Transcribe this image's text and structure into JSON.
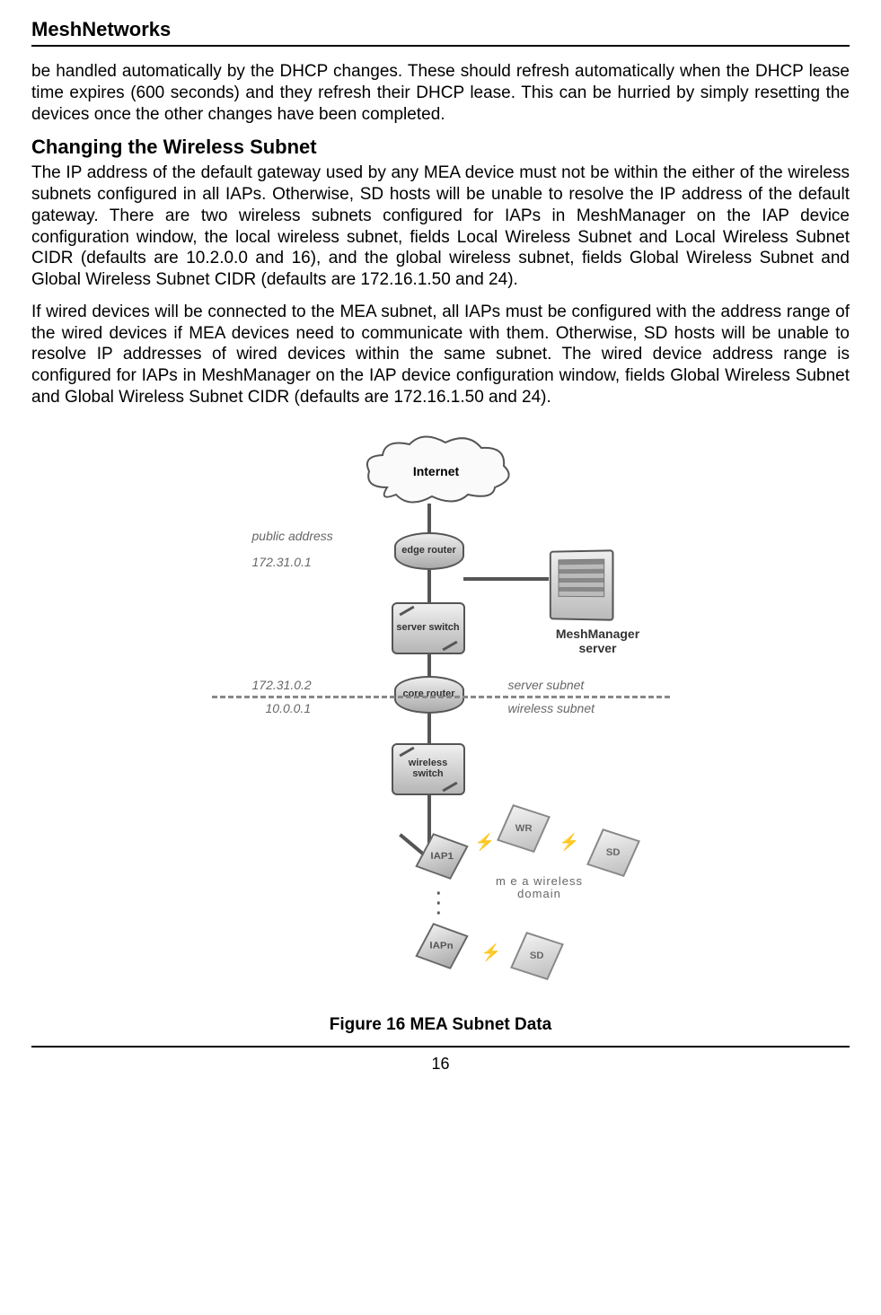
{
  "header": {
    "title": "MeshNetworks"
  },
  "body": {
    "p1": "be handled automatically by the DHCP changes.  These should refresh automatically when the DHCP lease time expires (600 seconds) and they refresh their DHCP lease.  This can be hurried by simply resetting the devices once the other changes have been completed.",
    "h1": "Changing the Wireless Subnet",
    "p2": "The IP address of the default gateway used by any MEA device must not be within the either of the wireless subnets configured in all IAPs.  Otherwise, SD hosts will be unable to resolve the IP address of the default gateway.  There are two wireless subnets configured for IAPs in MeshManager on the IAP device configuration window, the local wireless subnet, fields Local Wireless Subnet and Local Wireless Subnet CIDR (defaults are 10.2.0.0 and 16), and the global wireless subnet, fields Global Wireless Subnet and Global Wireless Subnet CIDR (defaults are 172.16.1.50 and 24).",
    "p3": "If wired devices will be connected to the MEA subnet, all IAPs must be configured with the address range of the wired devices if MEA devices need to communicate with them.  Otherwise, SD hosts will be unable to resolve IP addresses of wired devices within the same subnet.  The wired device address range is configured for IAPs in MeshManager on the IAP device configuration window, fields Global Wireless Subnet and Global Wireless Subnet CIDR (defaults are 172.16.1.50 and 24)."
  },
  "diagram": {
    "cloud": "Internet",
    "edge_router": "edge router",
    "public_address": "public address",
    "ip1": "172.31.0.1",
    "server_switch": "server switch",
    "core_router": "core router",
    "ip2": "172.31.0.2",
    "ip3": "10.0.0.1",
    "server_subnet": "server subnet",
    "wireless_subnet": "wireless subnet",
    "meshmanager": "MeshManager server",
    "wireless_switch": "wireless switch",
    "iap1": "IAP1",
    "iapn": "IAPn",
    "wr": "WR",
    "sd1": "SD",
    "sd2": "SD",
    "wd": "m e a wireless domain"
  },
  "figure": {
    "caption": "Figure 16       MEA Subnet Data"
  },
  "footer": {
    "page": "16"
  }
}
